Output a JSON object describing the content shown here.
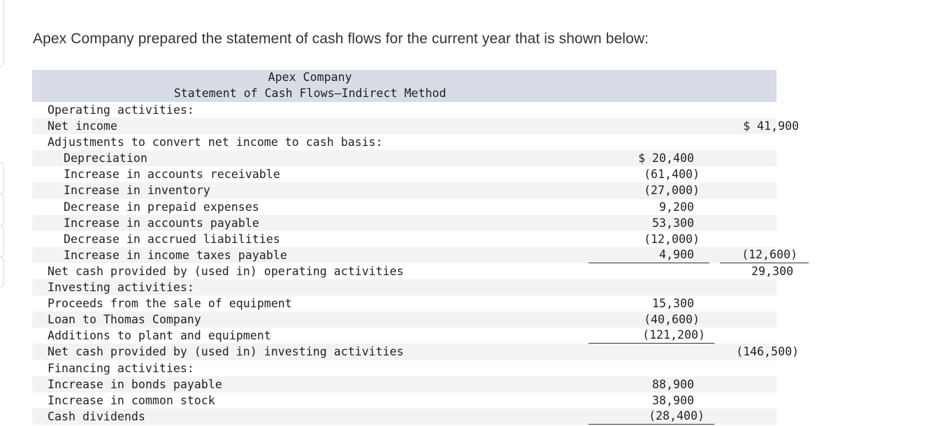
{
  "prompt_text": "Apex Company prepared the statement of cash flows for the current year that is shown below:",
  "statement": {
    "company": "Apex Company",
    "title": "Statement of Cash Flows—Indirect Method",
    "rows": [
      {
        "label": "Operating activities:",
        "col1": "",
        "col2": ""
      },
      {
        "label": "Net income",
        "col1": "",
        "col2": "$ 41,900"
      },
      {
        "label": "Adjustments to convert net income to cash basis:",
        "col1": "",
        "col2": ""
      },
      {
        "label": "Depreciation",
        "col1": "$ 20,400",
        "col2": ""
      },
      {
        "label": "Increase in accounts receivable",
        "col1": "(61,400)",
        "col2": ""
      },
      {
        "label": "Increase in inventory",
        "col1": "(27,000)",
        "col2": ""
      },
      {
        "label": "Decrease in prepaid expenses",
        "col1": "9,200",
        "col2": ""
      },
      {
        "label": "Increase in accounts payable",
        "col1": "53,300",
        "col2": ""
      },
      {
        "label": "Decrease in accrued liabilities",
        "col1": "(12,000)",
        "col2": ""
      },
      {
        "label": "Increase in income taxes payable",
        "col1": "4,900",
        "col2": "(12,600)"
      },
      {
        "label": "Net cash provided by (used in) operating activities",
        "col1": "",
        "col2": "29,300"
      },
      {
        "label": "Investing activities:",
        "col1": "",
        "col2": ""
      },
      {
        "label": "Proceeds from the sale of equipment",
        "col1": "15,300",
        "col2": ""
      },
      {
        "label": "Loan to Thomas Company",
        "col1": "(40,600)",
        "col2": ""
      },
      {
        "label": "Additions to plant and equipment",
        "col1": "(121,200)",
        "col2": ""
      },
      {
        "label": "Net cash provided by (used in) investing activities",
        "col1": "",
        "col2": "(146,500)"
      },
      {
        "label": "Financing activities:",
        "col1": "",
        "col2": ""
      },
      {
        "label": "Increase in bonds payable",
        "col1": "88,900",
        "col2": ""
      },
      {
        "label": "Increase in common stock",
        "col1": "38,900",
        "col2": ""
      },
      {
        "label": "Cash dividends",
        "col1": "(28,400)",
        "col2": ""
      }
    ]
  }
}
